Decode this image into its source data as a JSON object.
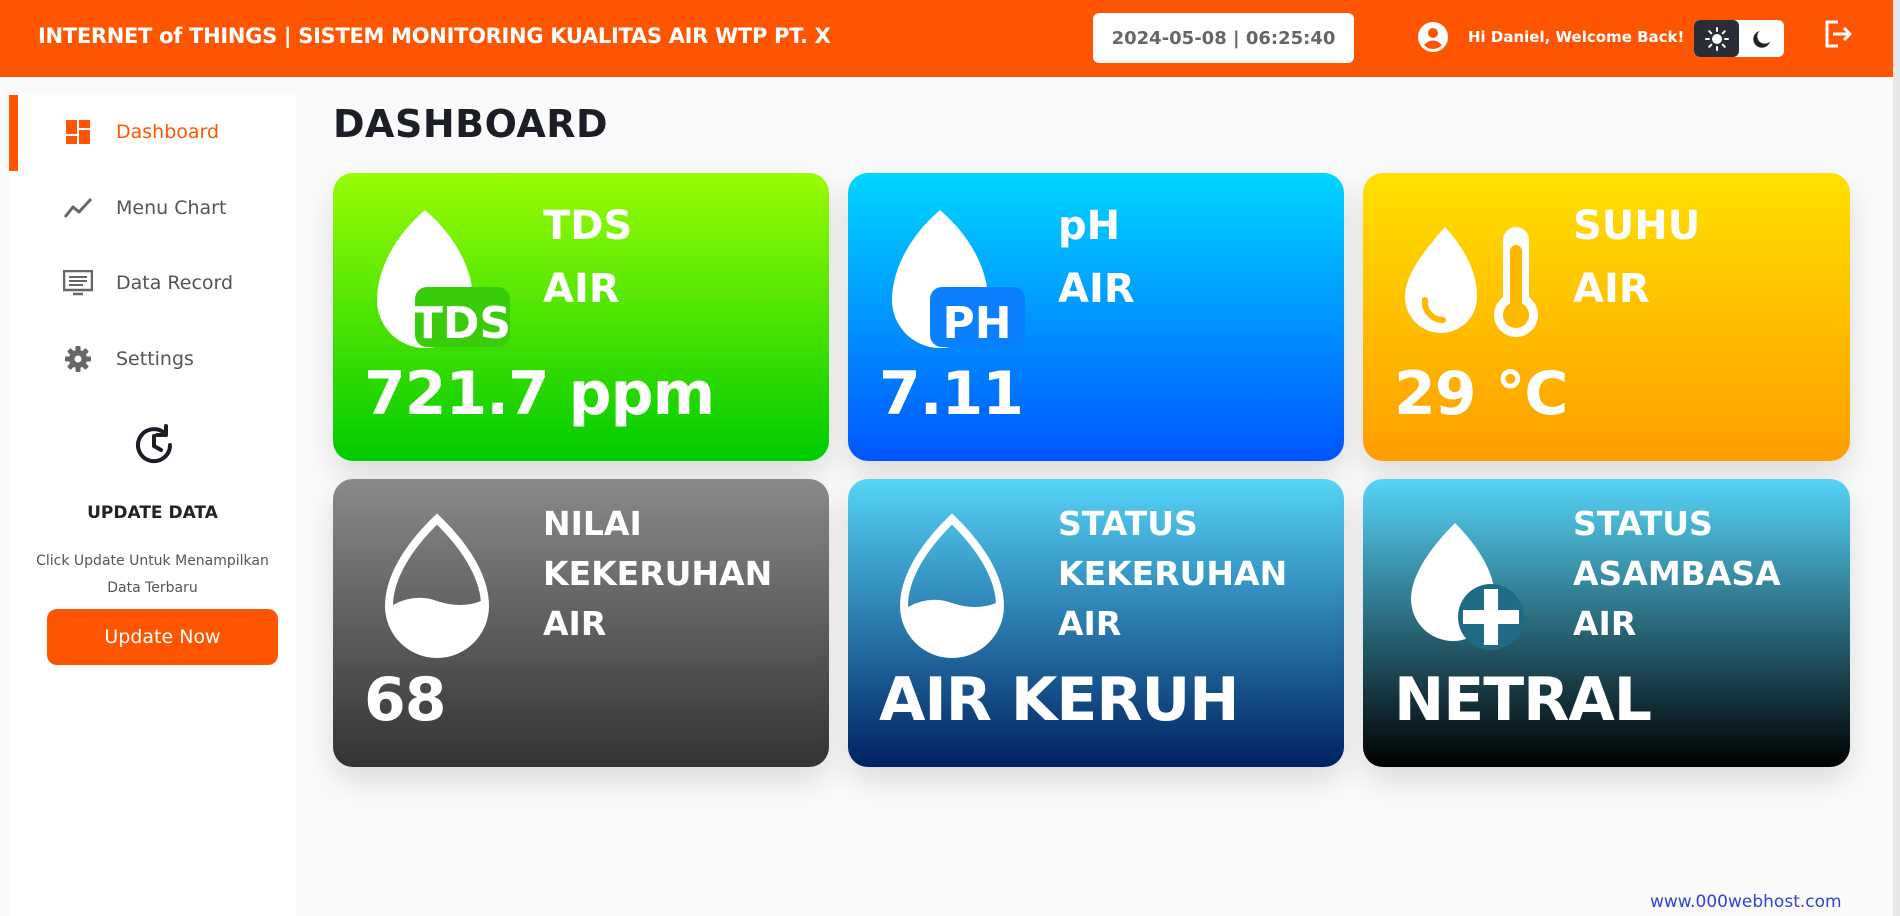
{
  "header": {
    "title": "INTERNET of THINGS | SISTEM MONITORING KUALITAS AIR WTP PT. X",
    "datetime": "2024-05-08 | 06:25:40",
    "welcome": "Hi Daniel, Welcome Back!"
  },
  "colors": {
    "accent": "#ff5500",
    "dark": "#2a2d36"
  },
  "sidebar": {
    "items": [
      {
        "label": "Dashboard",
        "icon": "dashboard-icon",
        "active": true
      },
      {
        "label": "Menu Chart",
        "icon": "chart-line-icon"
      },
      {
        "label": "Data Record",
        "icon": "monitor-icon"
      },
      {
        "label": "Settings",
        "icon": "gear-icon"
      }
    ],
    "update": {
      "title": "UPDATE DATA",
      "desc": "Click Update Untuk Menampilkan Data Terbaru",
      "button": "Update Now"
    }
  },
  "main": {
    "title": "DASHBOARD",
    "cards": [
      {
        "l1": "TDS",
        "l2": "AIR",
        "value": "721.7 ppm",
        "icon_text": "TDS"
      },
      {
        "l1": "pH",
        "l2": "AIR",
        "value": "7.11",
        "icon_text": "PH"
      },
      {
        "l1": "SUHU",
        "l2": "AIR",
        "value": "29 °C"
      },
      {
        "l1": "NILAI",
        "l2": "KEKERUHAN",
        "l3": "AIR",
        "value": "68"
      },
      {
        "l1": "STATUS",
        "l2": "KEKERUHAN",
        "l3": "AIR",
        "value": "AIR KERUH"
      },
      {
        "l1": "STATUS",
        "l2": "ASAMBASA",
        "l3": "AIR",
        "value": "NETRAL"
      }
    ]
  },
  "footer": {
    "watermark": "www.000webhost.com"
  }
}
